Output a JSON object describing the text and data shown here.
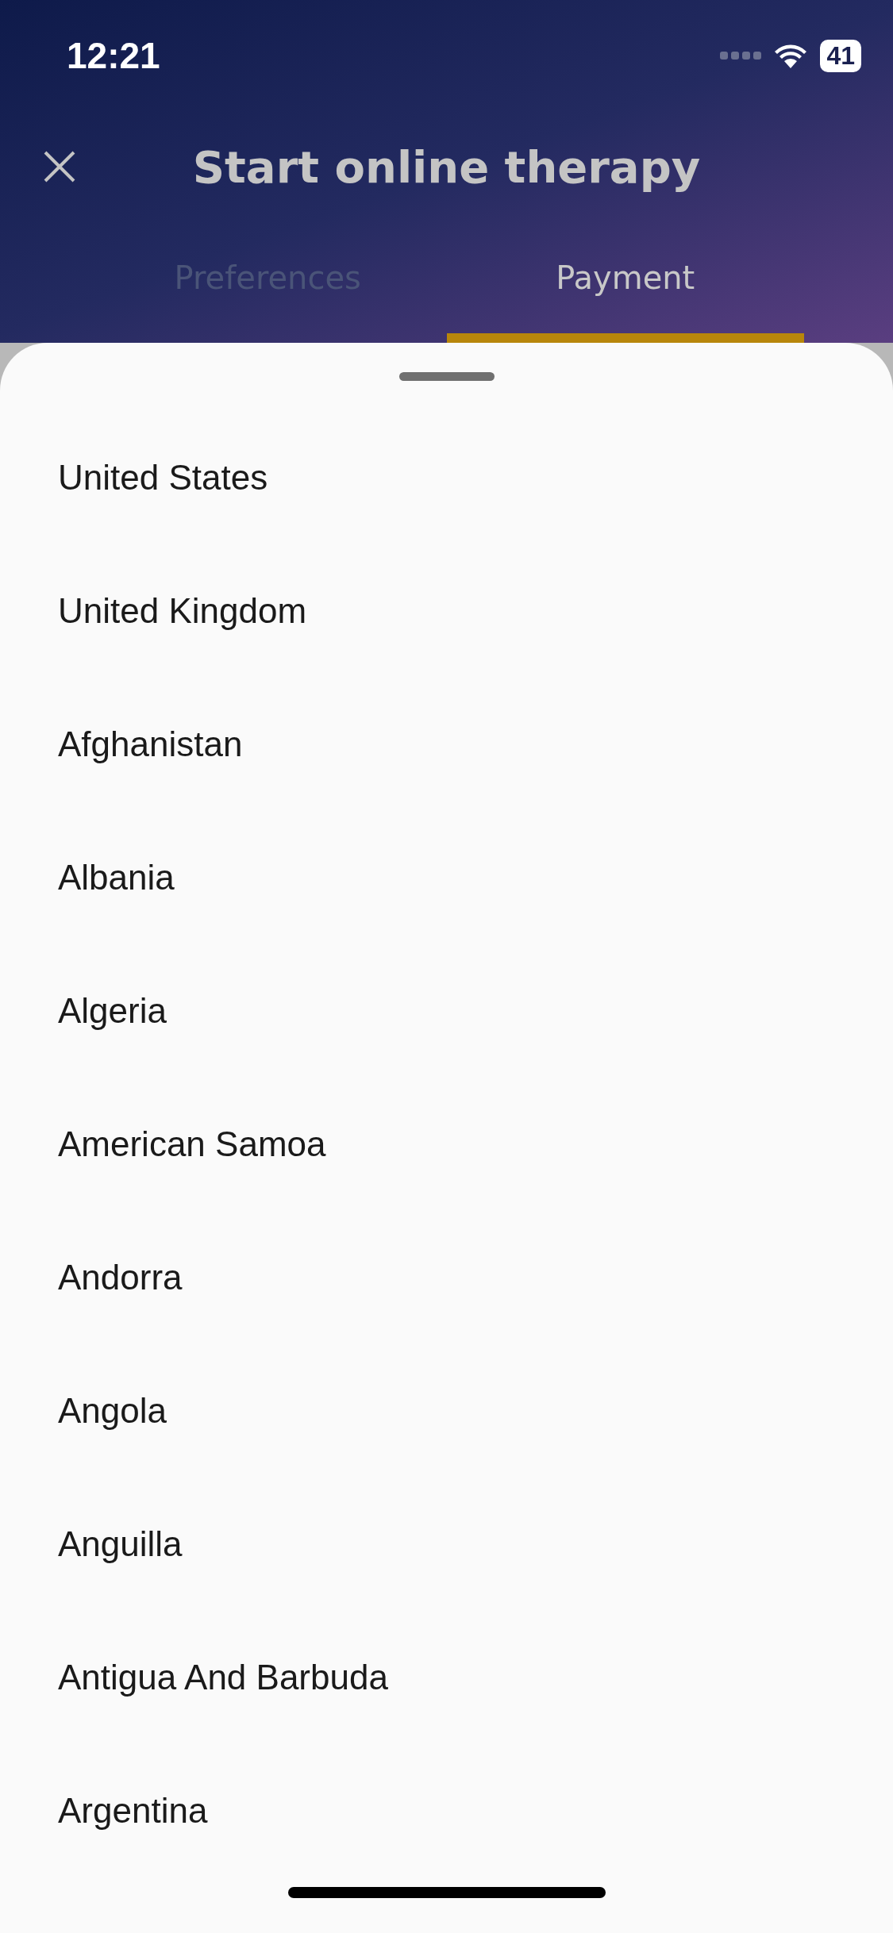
{
  "status_bar": {
    "time": "12:21",
    "battery": "41"
  },
  "header": {
    "title": "Start online therapy"
  },
  "tabs": [
    {
      "label": "Preferences",
      "selected": false
    },
    {
      "label": "Payment",
      "selected": true
    }
  ],
  "country_list": [
    "United States",
    "United Kingdom",
    "Afghanistan",
    "Albania",
    "Algeria",
    "American Samoa",
    "Andorra",
    "Angola",
    "Anguilla",
    "Antigua And Barbuda",
    "Argentina"
  ]
}
